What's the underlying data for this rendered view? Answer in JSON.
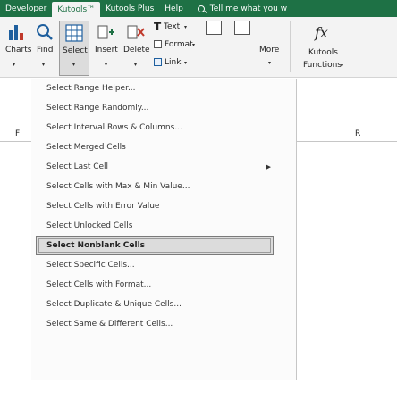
{
  "tabs": [
    {
      "label": "Developer"
    },
    {
      "label": "Kutools™"
    },
    {
      "label": "Kutools Plus"
    },
    {
      "label": "Help"
    }
  ],
  "tell_me": "Tell me what you w",
  "ribbon": {
    "charts_label": "Charts",
    "find_label": "Find",
    "select_label": "Select",
    "insert_label": "Insert",
    "delete_label": "Delete",
    "text_label": "Text",
    "format_label": "Format",
    "link_label": "Link",
    "more_label": "More",
    "kutools_label": "Kutools",
    "functions_label": "Functions",
    "fx_label": "fx"
  },
  "menu_items": [
    {
      "label": "Select Range Helper..."
    },
    {
      "label": "Select Range Randomly..."
    },
    {
      "label": "Select Interval Rows & Columns..."
    },
    {
      "label": "Select Merged Cells"
    },
    {
      "label": "Select Last Cell"
    },
    {
      "label": "Select Cells with Max & Min Value..."
    },
    {
      "label": "Select Cells with Error Value"
    },
    {
      "label": "Select Unlocked Cells"
    },
    {
      "label": "Select Nonblank Cells"
    },
    {
      "label": "Select Specific Cells..."
    },
    {
      "label": "Select Cells with Format..."
    },
    {
      "label": "Select Duplicate & Unique Cells..."
    },
    {
      "label": "Select Same & Different Cells..."
    }
  ],
  "columns": {
    "left": "F",
    "right": "R"
  }
}
